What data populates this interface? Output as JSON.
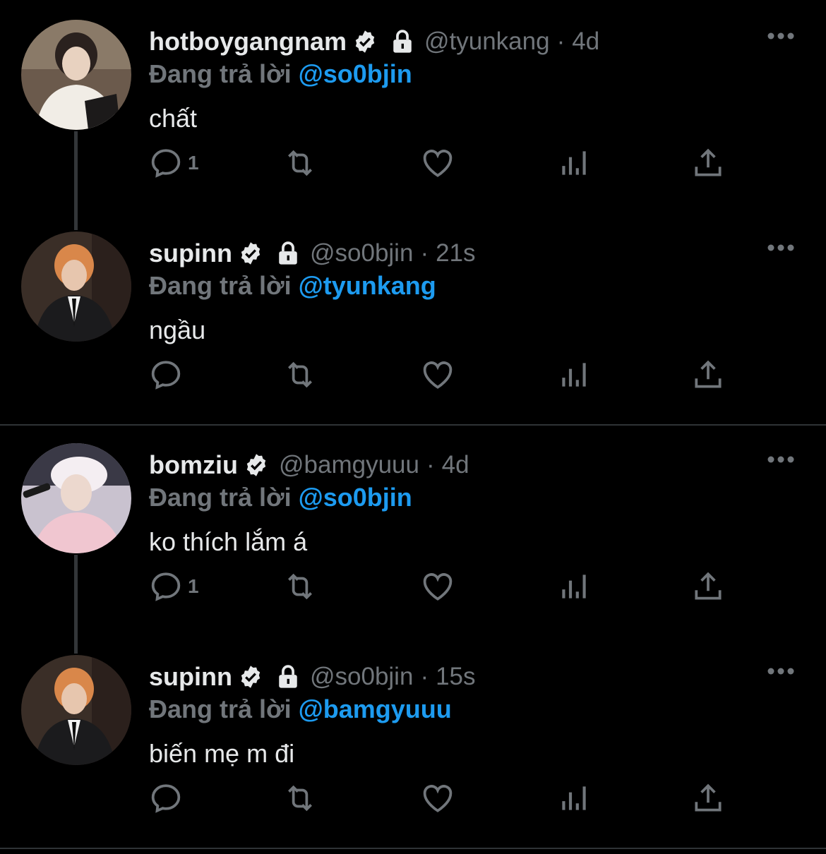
{
  "reply_prefix": "Đang trả lời",
  "tweets": [
    {
      "name": "hotboygangnam",
      "verified": true,
      "locked": true,
      "handle": "@tyunkang",
      "separator": "·",
      "time": "4d",
      "replying_to": "@so0bjin",
      "text": "chất",
      "reply_count": "1",
      "avatar": "hotboygangnam-avatar"
    },
    {
      "name": "supinn",
      "verified": true,
      "locked": true,
      "handle": "@so0bjin",
      "separator": "·",
      "time": "21s",
      "replying_to": "@tyunkang",
      "text": "ngầu",
      "reply_count": "",
      "avatar": "supinn-avatar"
    },
    {
      "name": "bomziu",
      "verified": true,
      "locked": false,
      "handle": "@bamgyuuu",
      "separator": "·",
      "time": "4d",
      "replying_to": "@so0bjin",
      "text": "ko thích lắm á",
      "reply_count": "1",
      "avatar": "bomziu-avatar"
    },
    {
      "name": "supinn",
      "verified": true,
      "locked": true,
      "handle": "@so0bjin",
      "separator": "·",
      "time": "15s",
      "replying_to": "@bamgyuuu",
      "text": "biến mẹ m đi",
      "reply_count": "",
      "avatar": "supinn-avatar"
    }
  ],
  "icons": {
    "reply": "reply-icon",
    "retweet": "retweet-icon",
    "like": "heart-icon",
    "views": "views-icon",
    "share": "share-icon",
    "more": "more-icon",
    "verified": "verified-badge-icon",
    "lock": "lock-icon"
  },
  "colors": {
    "background": "#000000",
    "text": "#e7e9ea",
    "muted": "#71767b",
    "accent": "#1d9bf0",
    "divider": "#2f3336"
  }
}
